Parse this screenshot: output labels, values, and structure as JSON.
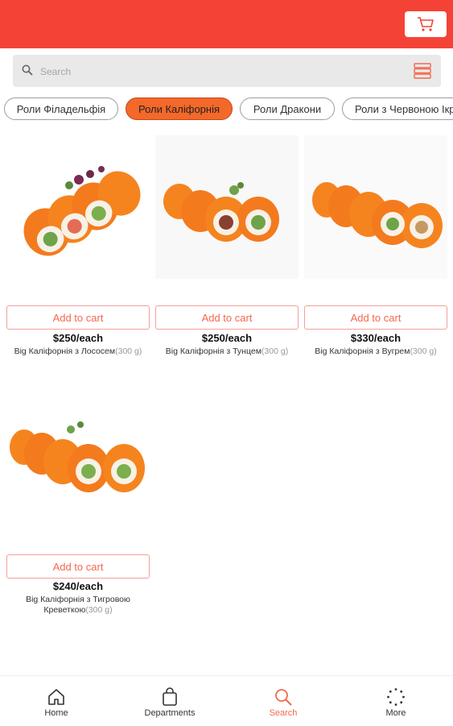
{
  "header": {
    "cart_icon": "cart-icon"
  },
  "search": {
    "placeholder": "Search",
    "value": "",
    "filter_icon": "filter-icon"
  },
  "categories": [
    {
      "label": "Роли Філадельфія",
      "active": false
    },
    {
      "label": "Роли Каліфорнія",
      "active": true
    },
    {
      "label": "Роли Дракони",
      "active": false
    },
    {
      "label": "Роли з Червоною Ікрою",
      "active": false
    }
  ],
  "products": [
    {
      "add_label": "Add to cart",
      "price": "$250/each",
      "name": "Big Каліфорнія з Лососем",
      "weight": "(300 g)"
    },
    {
      "add_label": "Add to cart",
      "price": "$250/each",
      "name": "Big Каліфорнія з Тунцем",
      "weight": "(300 g)"
    },
    {
      "add_label": "Add to cart",
      "price": "$330/each",
      "name": "Big Каліфорнія з Вугрем",
      "weight": "(300 g)"
    },
    {
      "add_label": "Add to cart",
      "price": "$240/each",
      "name": "Big Каліфорнія з Тигровою Креветкою",
      "weight": "(300 g)"
    }
  ],
  "bottom_nav": [
    {
      "label": "Home",
      "icon": "home-icon",
      "active": false
    },
    {
      "label": "Departments",
      "icon": "bag-icon",
      "active": false
    },
    {
      "label": "Search",
      "icon": "search-icon",
      "active": true
    },
    {
      "label": "More",
      "icon": "more-icon",
      "active": false
    }
  ],
  "colors": {
    "primary": "#f44336",
    "accent": "#f4682a"
  }
}
